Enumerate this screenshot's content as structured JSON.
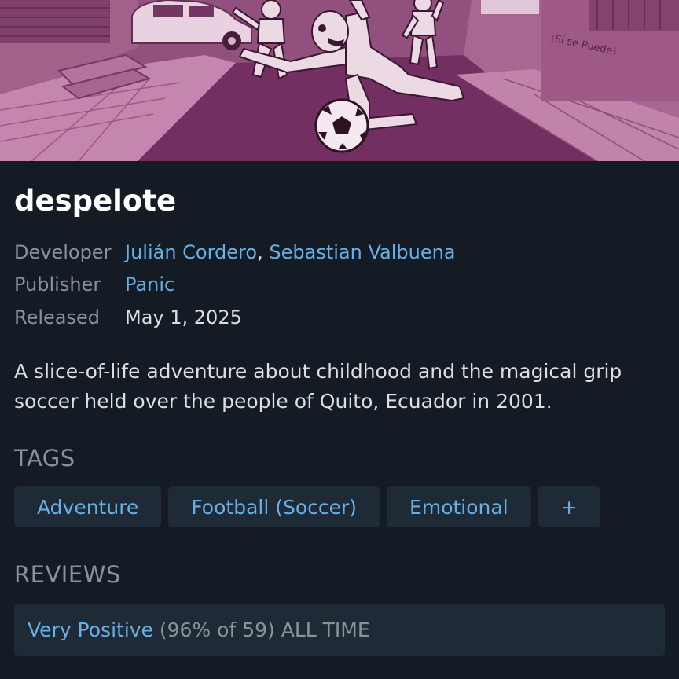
{
  "app": {
    "title": "despelote"
  },
  "hero": {
    "graffiti_text": "¡Sí se Puede!"
  },
  "details": {
    "developer_label": "Developer",
    "developers": [
      "Julián Cordero",
      "Sebastian Valbuena"
    ],
    "developer_separator": ",",
    "publisher_label": "Publisher",
    "publisher": "Panic",
    "released_label": "Released",
    "released": "May 1, 2025"
  },
  "description": "A slice-of-life adventure about childhood and the magical grip soccer held over the people of Quito, Ecuador in 2001.",
  "tags": {
    "heading": "TAGS",
    "items": [
      "Adventure",
      "Football (Soccer)",
      "Emotional"
    ],
    "more_label": "+"
  },
  "reviews": {
    "heading": "REVIEWS",
    "rating": "Very Positive",
    "detail": "(96% of 59) ALL TIME"
  },
  "colors": {
    "background": "#141b24",
    "link": "#67b0e6",
    "muted": "#8b9199",
    "text": "#dcdedf",
    "pill": "#1f2a37",
    "hero_tint": "#8a4a7c"
  }
}
